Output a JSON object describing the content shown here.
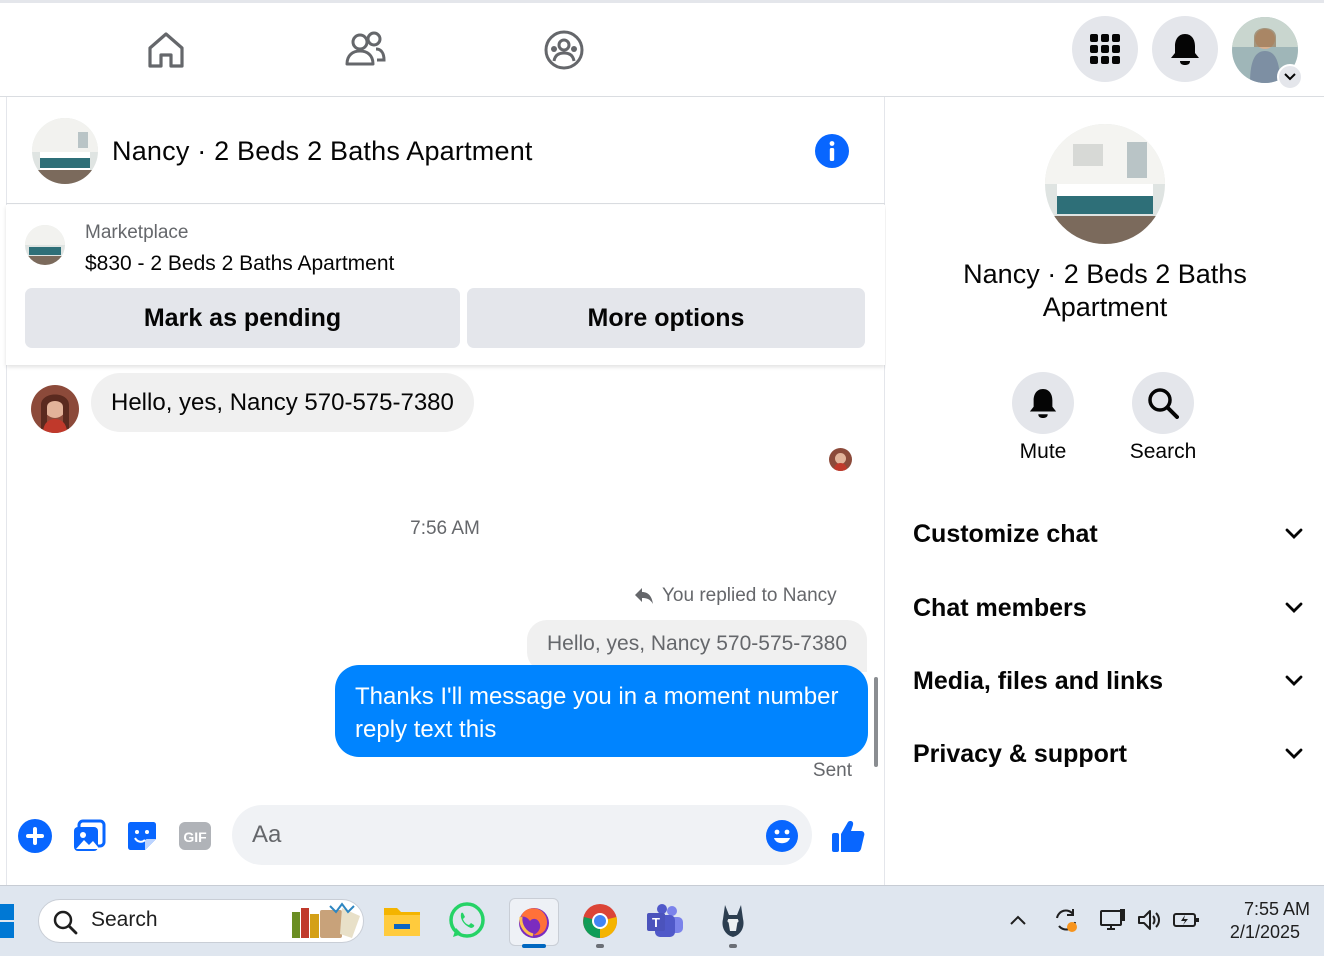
{
  "nav": {
    "home_icon": "home-icon",
    "friends_icon": "friends-icon",
    "groups_icon": "groups-icon",
    "menu_icon": "menu-grid-icon",
    "notifications_icon": "bell-icon",
    "profile_icon": "profile-avatar"
  },
  "chat": {
    "title": "Nancy · 2 Beds 2 Baths Apartment",
    "marketplace_label": "Marketplace",
    "listing": "$830 - 2 Beds 2 Baths Apartment",
    "mark_pending_label": "Mark as pending",
    "more_options_label": "More options",
    "incoming_message": "Hello, yes, Nancy 570-575-7380",
    "timestamp": "7:56 AM",
    "replied_label": "You replied to Nancy",
    "quoted_message": "Hello, yes, Nancy 570-575-7380",
    "outgoing_message": "Thanks I'll message you in a moment number reply text this",
    "status": "Sent",
    "input_placeholder": "Aa"
  },
  "right_panel": {
    "title": "Nancy · 2 Beds 2 Baths Apartment",
    "mute_label": "Mute",
    "search_label": "Search",
    "sections": [
      {
        "label": "Customize chat"
      },
      {
        "label": "Chat members"
      },
      {
        "label": "Media, files and links"
      },
      {
        "label": "Privacy & support"
      }
    ]
  },
  "taskbar": {
    "search_placeholder": "Search",
    "time": "7:55 AM",
    "date": "2/1/2025"
  },
  "colors": {
    "accent": "#0084ff",
    "facebook_blue": "#0866ff",
    "gray_button": "#e4e6eb"
  }
}
